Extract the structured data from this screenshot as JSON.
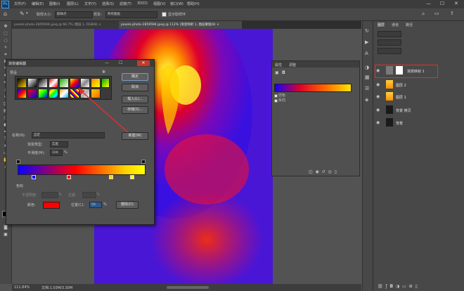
{
  "app": {
    "logo": "Ps"
  },
  "menu": [
    "文件(F)",
    "编辑(E)",
    "图像(I)",
    "图层(L)",
    "文字(Y)",
    "选择(S)",
    "滤镜(T)",
    "3D(D)",
    "视图(V)",
    "窗口(W)",
    "帮助(H)"
  ],
  "window_controls": {
    "minimize": "—",
    "maximize": "☐",
    "close": "✕"
  },
  "options_bar": {
    "sample_size_label": "取样大小:",
    "sample_size_value": "取样点",
    "sample_label": "样本:",
    "sample_value": "所有图层",
    "show_ring_label": "显示取样环",
    "show_ring_checked": true
  },
  "tabs": [
    {
      "label": "pexels-photo-2859594.jpeg @ 66.7% (图层 1, RGB/8) ×",
      "active": false
    },
    {
      "label": "pexels-photo-2859594.jpeg @ 112% (渐变映射 1, 图层蒙版/8) ×",
      "active": true
    }
  ],
  "status": {
    "zoom": "111.84%",
    "doc": "文档:1.03M/3.30M"
  },
  "layers_panel": {
    "tabs": [
      "图层",
      "通道",
      "路径"
    ],
    "layers": [
      {
        "name": "渐变映射 1",
        "type": "adjustment",
        "selected": true
      },
      {
        "name": "图层 2",
        "type": "gradient"
      },
      {
        "name": "图层 1",
        "type": "gradient"
      },
      {
        "name": "背景 拷贝",
        "type": "photo"
      },
      {
        "name": "背景",
        "type": "photo"
      }
    ]
  },
  "properties_panel": {
    "tabs": [
      "属性",
      "调整"
    ],
    "dither_label": "仿色",
    "reverse_label": "反向",
    "dither_checked": false,
    "reverse_checked": false
  },
  "dialog": {
    "title": "渐变编辑器",
    "presets_label": "预设",
    "buttons": {
      "ok": "确定",
      "cancel": "取消",
      "load": "载入(L)...",
      "save": "存储(S)...",
      "new": "新建(W)",
      "delete": "删除(D)"
    },
    "name_label": "名称(N):",
    "name_value": "自定",
    "type_label": "渐变类型:",
    "type_value": "实底",
    "smoothness_label": "平滑度(M):",
    "smoothness_value": "100",
    "percent": "%",
    "stops_label": "色标",
    "opacity_label": "不透明度:",
    "location_label": "位置:",
    "color_label": "颜色:",
    "color_location_label": "位置(C):",
    "color_location_value": "50",
    "stop_color": "#ff0000",
    "gradient_stops": [
      "#0a00ff",
      "#ff0000",
      "#ffd400",
      "#ffff00"
    ]
  },
  "colors": {
    "accent": "#31a8ff",
    "highlight_red": "#e03030",
    "gradient_preview": [
      "#1200ff",
      "#e0002a",
      "#ff6a00",
      "#ffe600"
    ]
  }
}
